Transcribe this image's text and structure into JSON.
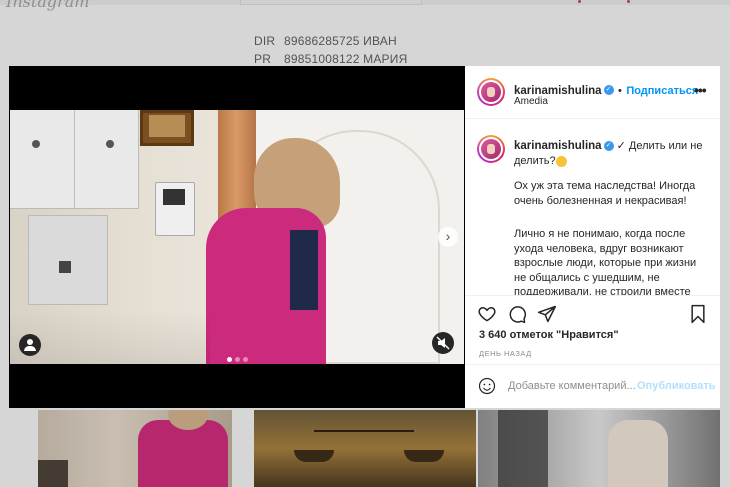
{
  "background": {
    "bio": [
      {
        "key": "DIR",
        "value": "89686285725 ИВАН"
      },
      {
        "key": "PR",
        "value": "89851008122 МАРИЯ"
      }
    ]
  },
  "post": {
    "username": "karinamishulina",
    "follow_label": "Подписаться",
    "location": "Amedia",
    "more_label": "•••",
    "caption_title": "✓ Делить или не делить?",
    "caption_paragraphs": [
      "Ох уж эта тема наследства! Иногда очень болезненная и некрасивая!",
      "Лично я не понимаю, когда после ухода человека, вдруг возникают взрослые люди, которые при жизни не общались с ушедшим, не поддерживали, не строили вместе б..."
    ],
    "likes": "3 640 отметок \"Нравится\"",
    "time": "ДЕНЬ НАЗАД",
    "comment_placeholder": "Добавьте комментарий...",
    "post_button": "Опубликовать",
    "carousel": {
      "total": 3,
      "active": 1
    }
  },
  "colors": {
    "accent": "#0095f6",
    "jacket": "#cc2a7d",
    "verified": "#3897f0"
  },
  "icons": [
    "heart-icon",
    "comment-icon",
    "share-icon",
    "bookmark-icon",
    "smile-icon",
    "mute-icon",
    "tag-user-icon",
    "chevron-right-icon",
    "verified-icon"
  ]
}
